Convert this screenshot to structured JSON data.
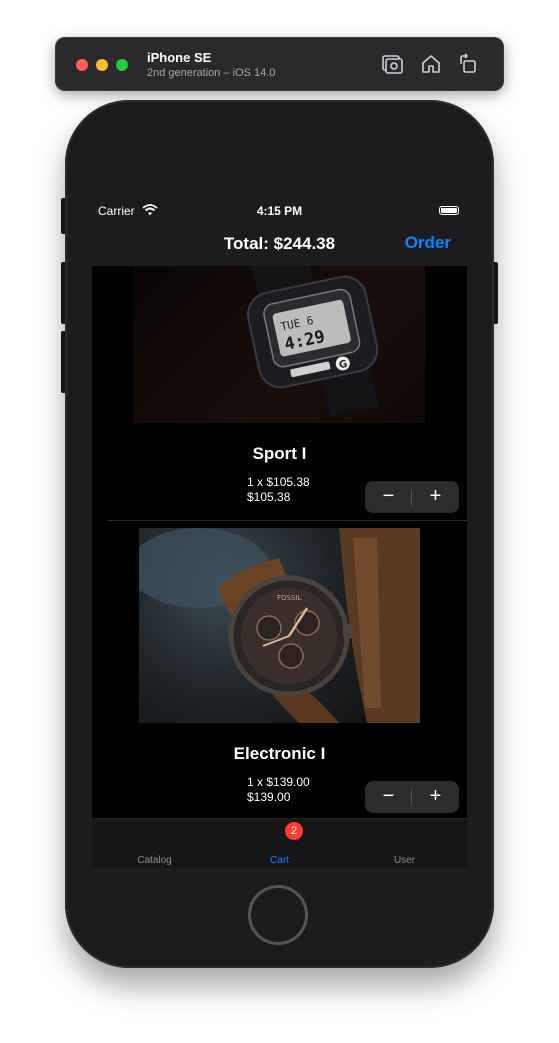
{
  "simulator": {
    "device_name": "iPhone SE",
    "device_detail": "2nd generation – iOS 14.0",
    "icons": [
      "screenshot-icon",
      "home-icon",
      "rotate-icon"
    ]
  },
  "status_bar": {
    "carrier": "Carrier",
    "time": "4:15 PM"
  },
  "nav": {
    "title": "Total: $244.38",
    "order_label": "Order"
  },
  "cart": {
    "items": [
      {
        "name": "Sport I",
        "quantity_line": "1 x $105.38",
        "subtotal": "$105.38",
        "image_icon": "g-shock-watch-photo"
      },
      {
        "name": "Electronic I",
        "quantity_line": "1 x $139.00",
        "subtotal": "$139.00",
        "image_icon": "fossil-watch-photo"
      }
    ],
    "stepper": {
      "minus": "−",
      "plus": "+"
    }
  },
  "tab_bar": {
    "tabs": [
      {
        "label": "Catalog"
      },
      {
        "label": "Cart",
        "badge": "2"
      },
      {
        "label": "User"
      }
    ],
    "active_color": "#0a84ff",
    "badge_color": "#ff3b30"
  }
}
